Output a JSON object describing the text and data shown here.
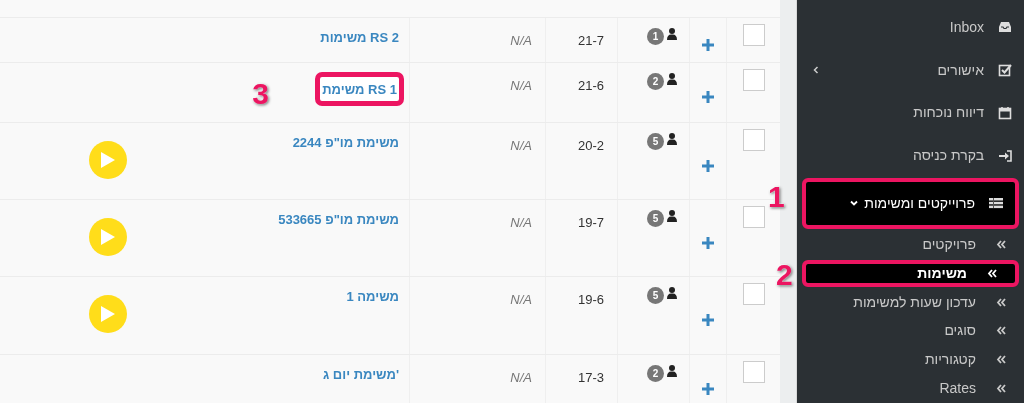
{
  "table": {
    "rows": [
      {
        "name": "משימות RS 2",
        "na": "N/A",
        "id": "21-7",
        "count": "1",
        "checked": false,
        "play": false
      },
      {
        "name": "משימת RS 1",
        "na": "N/A",
        "id": "21-6",
        "count": "2",
        "checked": false,
        "play": false,
        "callout": "3"
      },
      {
        "name": "משימת מו\"פ 2244",
        "na": "N/A",
        "id": "20-2",
        "count": "5",
        "checked": false,
        "play": true
      },
      {
        "name": "משימת מו\"פ 533665",
        "na": "N/A",
        "id": "19-7",
        "count": "5",
        "checked": false,
        "play": true
      },
      {
        "name": "משימה 1",
        "na": "N/A",
        "id": "19-6",
        "count": "5",
        "checked": false,
        "play": true
      },
      {
        "name": "משימת יום ג'",
        "na": "N/A",
        "id": "17-3",
        "count": "2",
        "checked": false,
        "play": false
      }
    ]
  },
  "sidebar": {
    "items": [
      {
        "label": "Inbox",
        "kind": "item"
      },
      {
        "label": "אישורים",
        "kind": "item",
        "expanded": false
      },
      {
        "label": "דיווח נוכחות",
        "kind": "item"
      },
      {
        "label": "בקרת כניסה",
        "kind": "item"
      },
      {
        "label": "פרוייקטים ומשימות",
        "kind": "item",
        "expanded": true,
        "selected": true,
        "callout": "1"
      },
      {
        "label": "פרויקטים",
        "kind": "sub",
        "selected": false
      },
      {
        "label": "משימות",
        "kind": "sub",
        "selected": true,
        "callout": "2"
      },
      {
        "label": "עדכון שעות למשימות",
        "kind": "sub",
        "selected": false
      },
      {
        "label": "סוגים",
        "kind": "sub",
        "selected": false
      },
      {
        "label": "קטגוריות",
        "kind": "sub",
        "selected": false
      },
      {
        "label": "Rates",
        "kind": "sub",
        "selected": false
      }
    ]
  }
}
